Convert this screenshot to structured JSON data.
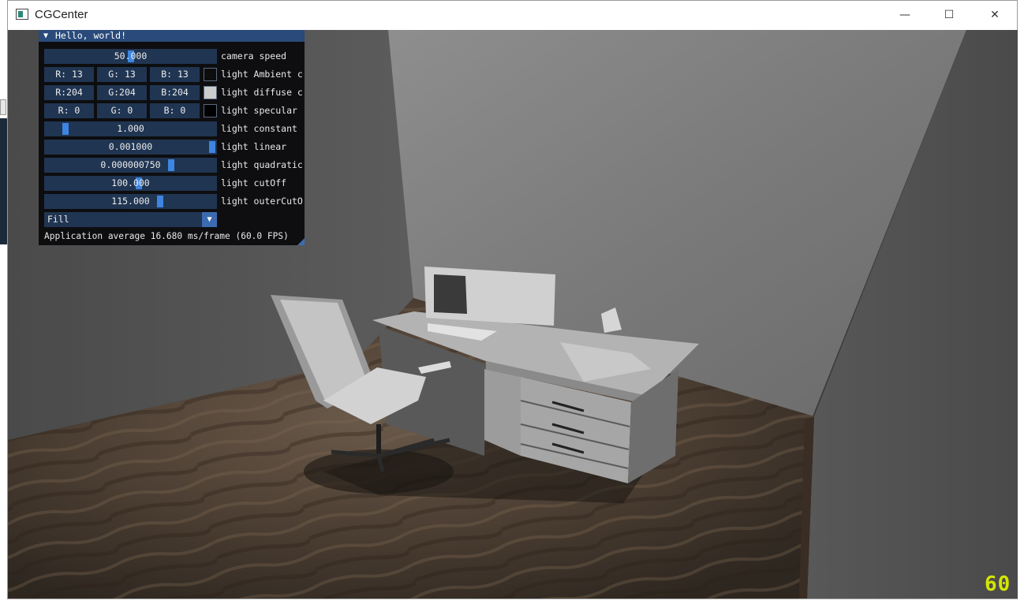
{
  "window": {
    "title": "CGCenter",
    "minimize_symbol": "—",
    "maximize_symbol": "☐",
    "close_symbol": "✕"
  },
  "imgui": {
    "title": "Hello, world!",
    "collapse_arrow": "▼",
    "camera_speed": {
      "value": "50.000",
      "label": "camera speed",
      "fraction": 0.5
    },
    "ambient": {
      "r": "R: 13",
      "g": "G: 13",
      "b": "B: 13",
      "label": "light Ambient c",
      "swatch": "#0d0d0d"
    },
    "diffuse": {
      "r": "R:204",
      "g": "G:204",
      "b": "B:204",
      "label": "light diffuse c",
      "swatch": "#cccccc"
    },
    "specular": {
      "r": "R:  0",
      "g": "G:  0",
      "b": "B:  0",
      "label": "light specular",
      "swatch": "#000000"
    },
    "constant": {
      "value": "1.000",
      "label": "light constant",
      "fraction": 0.1
    },
    "linear": {
      "value": "0.001000",
      "label": "light linear",
      "fraction": 1.0
    },
    "quadratic": {
      "value": "0.000000750",
      "label": "light quadratic",
      "fraction": 0.75
    },
    "cutoff": {
      "value": "100.000",
      "label": "light cutOff",
      "fraction": 0.55
    },
    "outer_cutoff": {
      "value": "115.000",
      "label": "light outerCutO",
      "fraction": 0.68
    },
    "polygon_mode": {
      "value": "Fill",
      "arrow": "▼"
    },
    "status": "Application average 16.680 ms/frame (60.0 FPS)"
  },
  "fps_counter": "60",
  "colors": {
    "imgui_header": "#294a7a",
    "imgui_frame": "#203552",
    "slider_grab": "#3d85e0",
    "fps_text": "#d6e600"
  }
}
